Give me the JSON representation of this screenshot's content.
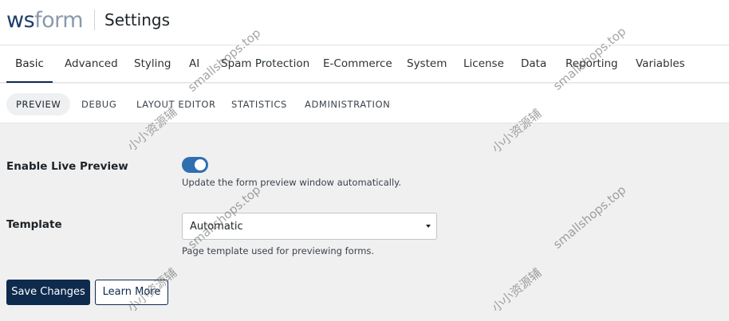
{
  "header": {
    "logo_ws": "ws",
    "logo_form": "form",
    "title": "Settings"
  },
  "tabs": [
    {
      "label": "Basic",
      "active": true
    },
    {
      "label": "Advanced"
    },
    {
      "label": "Styling"
    },
    {
      "label": "AI"
    },
    {
      "label": "Spam Protection"
    },
    {
      "label": "E-Commerce"
    },
    {
      "label": "System"
    },
    {
      "label": "License"
    },
    {
      "label": "Data"
    },
    {
      "label": "Reporting"
    },
    {
      "label": "Variables"
    }
  ],
  "subtabs": [
    {
      "label": "PREVIEW",
      "active": true
    },
    {
      "label": "DEBUG"
    },
    {
      "label": "LAYOUT EDITOR"
    },
    {
      "label": "STATISTICS"
    },
    {
      "label": "ADMINISTRATION"
    }
  ],
  "settings": {
    "live_preview": {
      "label": "Enable Live Preview",
      "enabled": true,
      "help": "Update the form preview window automatically."
    },
    "template": {
      "label": "Template",
      "value": "Automatic",
      "help": "Page template used for previewing forms."
    }
  },
  "buttons": {
    "save": "Save Changes",
    "learn_more": "Learn More"
  },
  "watermarks": {
    "domain": "smallshops.top",
    "cn": "小小资源辅"
  },
  "colors": {
    "brand_navy": "#0e2a4d",
    "toggle_on": "#2f6fb0",
    "logo_ws": "#1e3d6b",
    "logo_form": "#8a9aad"
  }
}
